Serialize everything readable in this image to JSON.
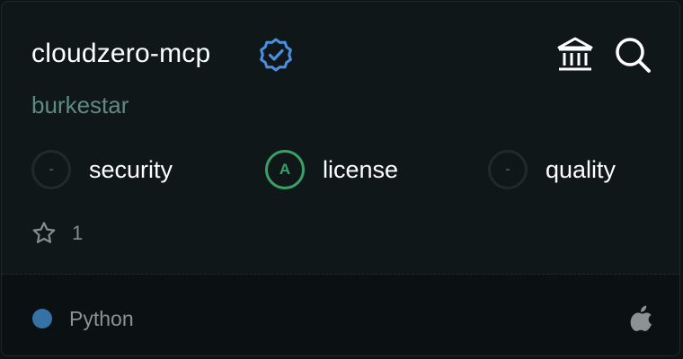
{
  "card": {
    "title": "cloudzero-mcp",
    "author": "burkestar",
    "verified_icon": "verified-badge-icon",
    "actions": [
      {
        "icon": "bank-icon"
      },
      {
        "icon": "search-icon"
      }
    ],
    "scores": [
      {
        "grade": "-",
        "label": "security"
      },
      {
        "grade": "A",
        "label": "license"
      },
      {
        "grade": "-",
        "label": "quality"
      }
    ],
    "stars": {
      "icon": "star-icon",
      "count": "1"
    },
    "footer": {
      "language": "Python",
      "language_color": "#3572a5",
      "platform_icon": "apple-icon"
    }
  }
}
